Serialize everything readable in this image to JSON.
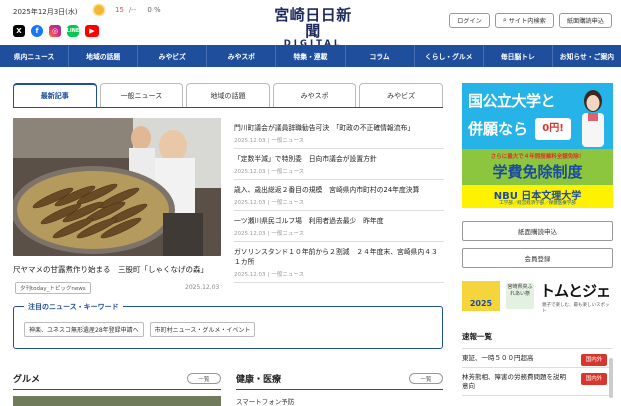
{
  "header": {
    "date": "2025年12月3日(水)",
    "weather": {
      "icon": "sun-icon",
      "temp_high": "15",
      "temp_sep": "/--",
      "rain": "0 %"
    },
    "logo_main": "宮崎日日新聞",
    "logo_sub": "DIGITAL",
    "buttons": {
      "login": "ログイン",
      "search": "サイト内検索",
      "subscribe": "紙面購読申込"
    },
    "social": [
      "x-icon",
      "facebook-icon",
      "instagram-icon",
      "line-icon",
      "youtube-icon"
    ]
  },
  "nav": [
    "県内ニュース",
    "地域の話題",
    "みやビズ",
    "みやスポ",
    "特集・連載",
    "コラム",
    "くらし・グルメ",
    "毎日脳トレ",
    "お知らせ・ご案内"
  ],
  "tabs": [
    "最新記事",
    "一般ニュース",
    "地域の話題",
    "みやスポ",
    "みやビズ"
  ],
  "feature": {
    "caption": "尺ヤマメの甘露煮作り始まる　三股町「しゃくなげの森」",
    "tag": "夕刊today_トピックnews",
    "date": "2025.12.03"
  },
  "articles": [
    {
      "title": "門川町議会が議員辞職勧告可決　「町政の不正確情報流布」",
      "date": "2025.12.03",
      "category": "一般ニュース"
    },
    {
      "title": "「定数半減」で特別委　日向市議会が設置方針",
      "date": "2025.12.03",
      "category": "一般ニュース"
    },
    {
      "title": "歳入、歳出総返２番目の規模　宮崎県内市町村の24年度決算",
      "date": "2025.12.03",
      "category": "一般ニュース"
    },
    {
      "title": "一ツ瀬川県民ゴルフ場　利用者過去最少　昨年度",
      "date": "2025.12.03",
      "category": "一般ニュース"
    },
    {
      "title": "ガソリンスタンド１０年前から２割減　２４年度末、宮崎県内４３１カ所",
      "date": "2025.12.03",
      "category": "一般ニュース"
    }
  ],
  "keywords": {
    "title": "注目のニュース・キーワード",
    "chips": [
      "神楽、ユネスコ無形遺産28年登録申請へ",
      "市町村ニュース・グルメ・イベント"
    ]
  },
  "sections": {
    "gourmet": {
      "title": "グルメ",
      "more": "一覧"
    },
    "health": {
      "title": "健康・医療",
      "more": "一覧",
      "sub": "スマートフォン予防"
    }
  },
  "sidebar": {
    "ad": {
      "line1": "国公立大学と",
      "line2": "併願なら",
      "badge": "0円!",
      "mid_small": "さらに最大で４年間授業料全額免除！",
      "mid_big": "学費免除制度",
      "name": "NBU 日本文理大学",
      "sub": "工学部／経営経済学部／保健医療学部"
    },
    "btn_paper": "紙面購読申込",
    "btn_member": "会員登録",
    "ad2": {
      "year": "2025",
      "mid": "宮崎県央ふれあい祭",
      "text": "トムとジェ",
      "sub": "親子で楽しむ、最も楽しいスポット"
    },
    "flash_title": "速報一覧",
    "flash": [
      {
        "text": "東証、一時５００円超高",
        "badge": "国内外"
      },
      {
        "text": "林芳熊相、障害の労務費問題を説明意向",
        "badge": "国内外"
      }
    ]
  }
}
